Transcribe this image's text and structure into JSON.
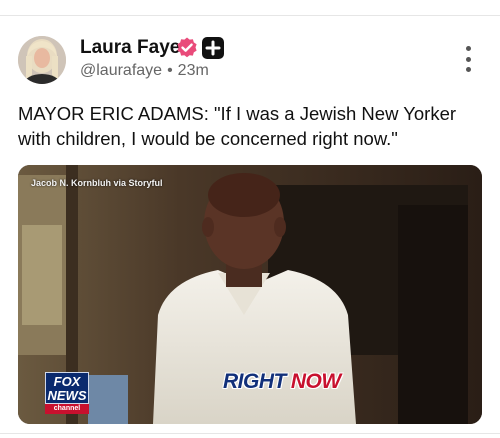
{
  "post": {
    "author": {
      "name": "Laura Faye",
      "handle": "@laurafaye",
      "time": "23m"
    },
    "text": "MAYOR ERIC ADAMS: \"If I was a Jewish New Yorker with children, I would be concerned right now.\"",
    "media": {
      "credit": "Jacob N. Kornbluh via Storyful",
      "network_logo_top": "FOX NEWS",
      "network_logo_bottom": "channel",
      "chyron_word_1": "RIGHT",
      "chyron_word_2": "NOW"
    }
  },
  "icons": {
    "verified": "verified-badge-icon",
    "plus": "plus-badge-icon",
    "more": "more-vertical-icon"
  },
  "colors": {
    "verified_pink": "#e94b7a",
    "fox_blue": "#0a2a6e",
    "fox_red": "#c8102e",
    "text_primary": "#111111",
    "text_secondary": "#666666"
  }
}
